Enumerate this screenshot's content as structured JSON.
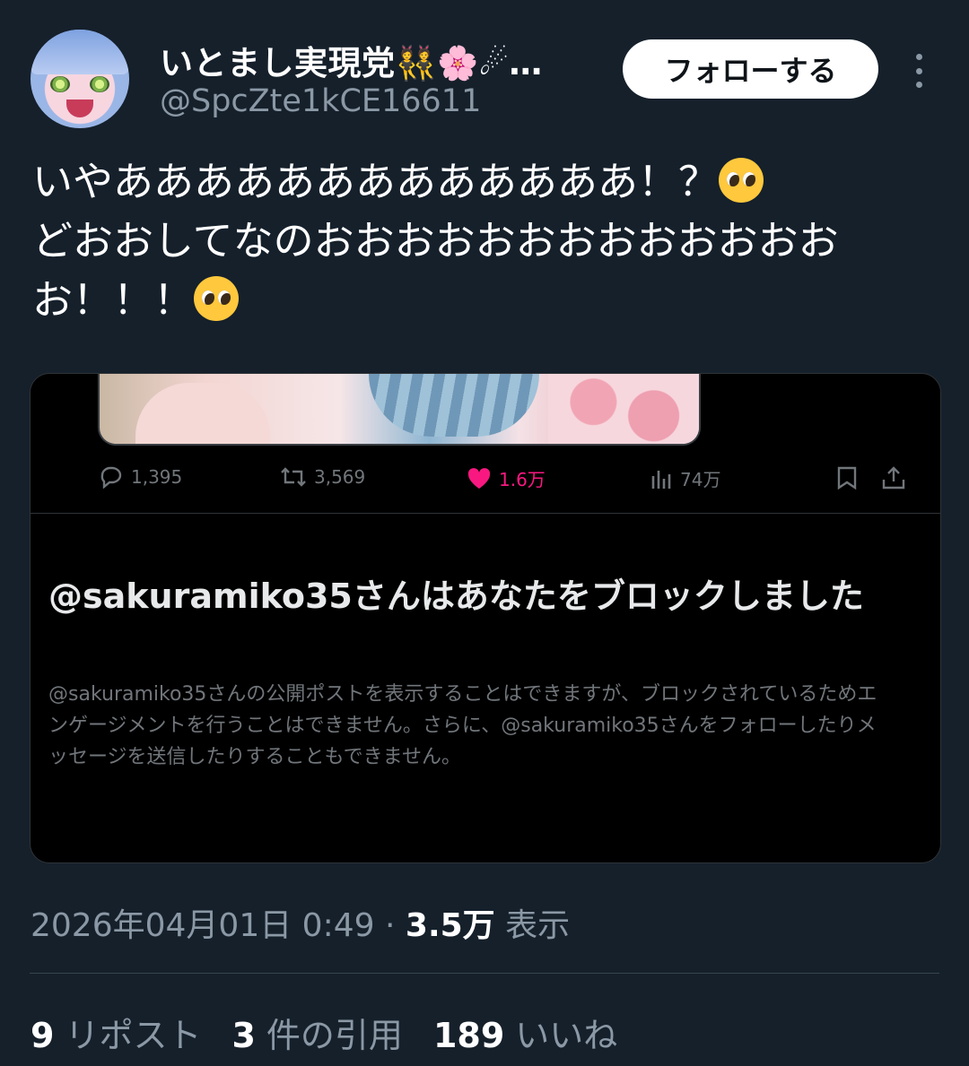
{
  "author": {
    "name": "いとまし実現党👯🌸☄…",
    "handle": "@SpcZte1kCE16611"
  },
  "follow_button": "フォローする",
  "tweet": {
    "line1": "いやあああああああああああああ！？",
    "line2": "どおおしてなのおおおおおおおおおおおおおお！！！"
  },
  "embedded": {
    "replies": "1,395",
    "reposts": "3,569",
    "likes": "1.6万",
    "views": "74万",
    "block_title": "@sakuramiko35さんはあなたをブロックしました",
    "block_description": "@sakuramiko35さんの公開ポストを表示することはできますが、ブロックされているためエンゲージメントを行うことはできません。さらに、@sakuramiko35さんをフォローしたりメッセージを送信したりすることもできません。"
  },
  "meta": {
    "datetime": "2026年04月01日 0:49",
    "separator": "·",
    "view_count": "3.5万",
    "view_label": "表示"
  },
  "stats": {
    "reposts_count": "9",
    "reposts_label": "リポスト",
    "quotes_count": "3",
    "quotes_label": "件の引用",
    "likes_count": "189",
    "likes_label": "いいね"
  },
  "colors": {
    "background": "#15202b",
    "like_accent": "#f91880",
    "muted_text": "#8b98a5"
  }
}
